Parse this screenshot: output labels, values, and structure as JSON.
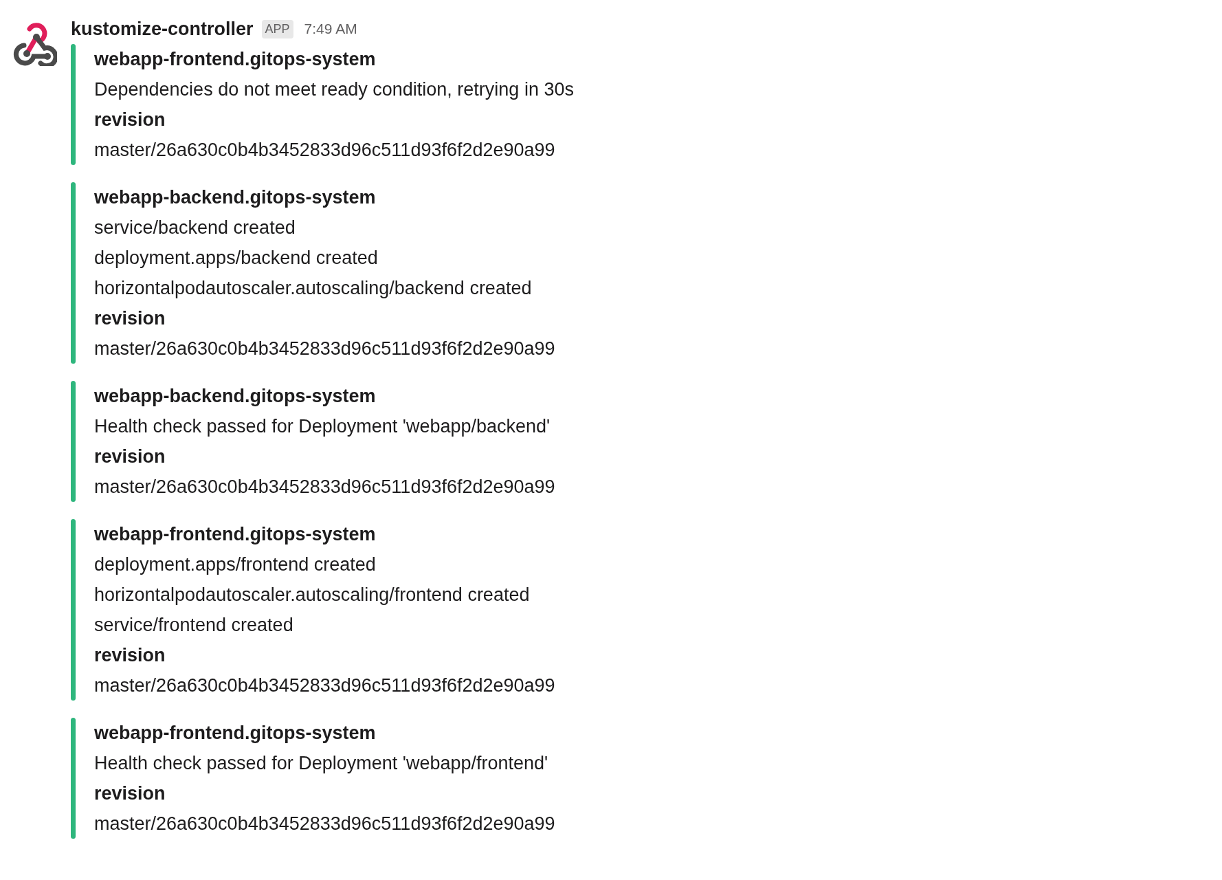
{
  "message": {
    "sender": "kustomize-controller",
    "badge": "APP",
    "time": "7:49 AM",
    "attachments": [
      {
        "color": "#2eb67d",
        "title": "webapp-frontend.gitops-system",
        "lines": [
          "Dependencies do not meet ready condition, retrying in 30s"
        ],
        "field_title": "revision",
        "field_value": "master/26a630c0b4b3452833d96c511d93f6f2d2e90a99"
      },
      {
        "color": "#2eb67d",
        "title": "webapp-backend.gitops-system",
        "lines": [
          "service/backend created",
          "deployment.apps/backend created",
          "horizontalpodautoscaler.autoscaling/backend created"
        ],
        "field_title": "revision",
        "field_value": "master/26a630c0b4b3452833d96c511d93f6f2d2e90a99"
      },
      {
        "color": "#2eb67d",
        "title": "webapp-backend.gitops-system",
        "lines": [
          "Health check passed for Deployment 'webapp/backend'"
        ],
        "field_title": "revision",
        "field_value": "master/26a630c0b4b3452833d96c511d93f6f2d2e90a99"
      },
      {
        "color": "#2eb67d",
        "title": "webapp-frontend.gitops-system",
        "lines": [
          "deployment.apps/frontend created",
          "horizontalpodautoscaler.autoscaling/frontend created",
          "service/frontend created"
        ],
        "field_title": "revision",
        "field_value": "master/26a630c0b4b3452833d96c511d93f6f2d2e90a99"
      },
      {
        "color": "#2eb67d",
        "title": "webapp-frontend.gitops-system",
        "lines": [
          "Health check passed for Deployment 'webapp/frontend'"
        ],
        "field_title": "revision",
        "field_value": "master/26a630c0b4b3452833d96c511d93f6f2d2e90a99"
      }
    ]
  }
}
